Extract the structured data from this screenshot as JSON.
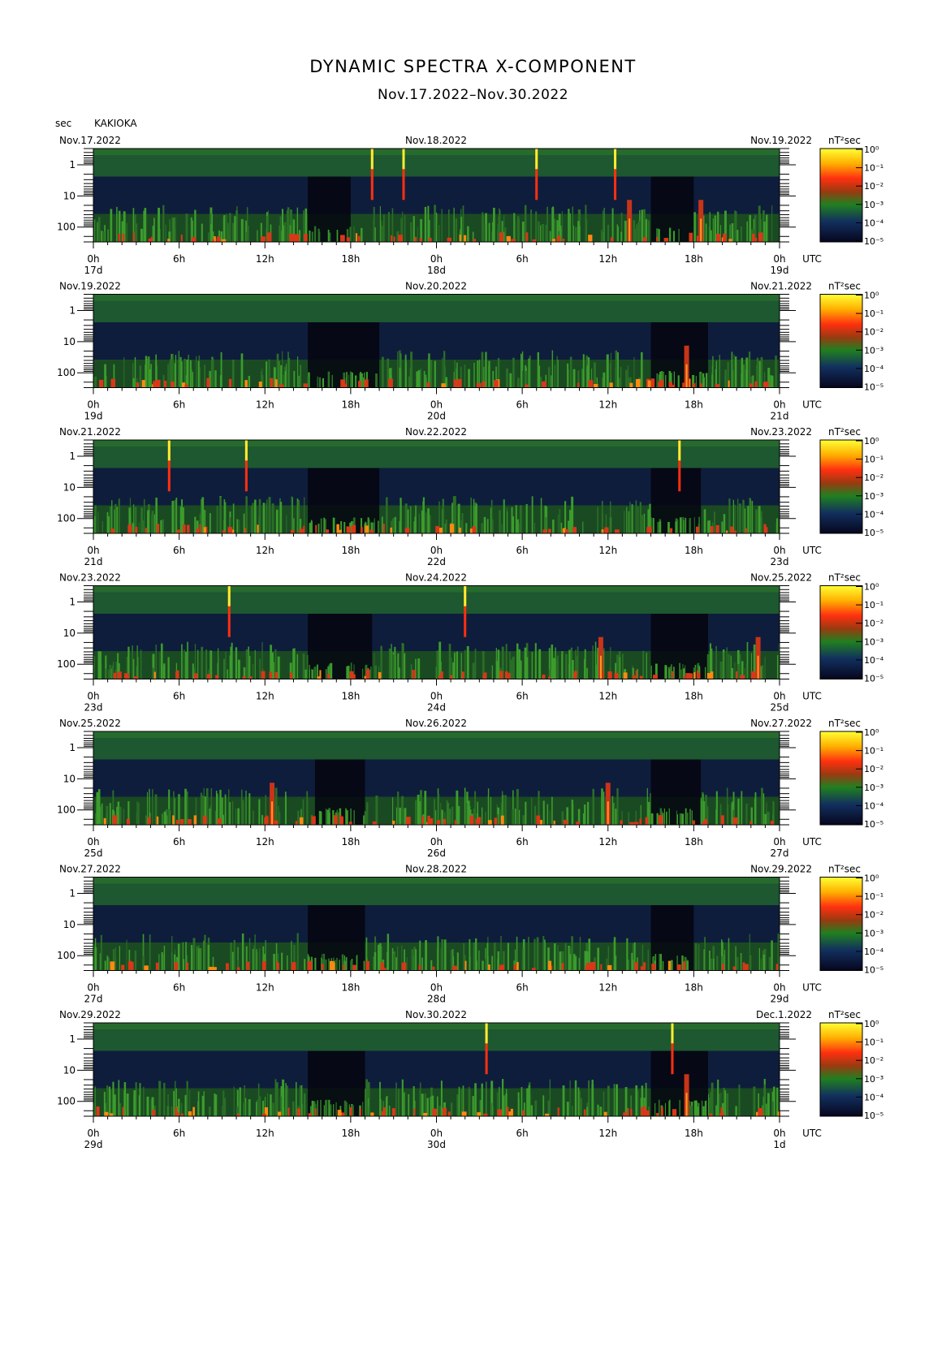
{
  "title": "DYNAMIC SPECTRA X-COMPONENT",
  "subtitle": "Nov.17.2022–Nov.30.2022",
  "station": "KAKIOKA",
  "period_unit": "sec",
  "colorbar_unit": "nT²sec",
  "utc_label": "UTC",
  "chart_data": {
    "type": "heatmap",
    "y_axis": {
      "label": "sec",
      "scale": "log",
      "range": [
        0.3,
        300
      ],
      "ticks": [
        "1",
        "10",
        "100"
      ],
      "direction": "increasing downward"
    },
    "x_ticks": [
      "0h",
      "6h",
      "12h",
      "18h",
      "0h",
      "6h",
      "12h",
      "18h",
      "0h"
    ],
    "colorscale": {
      "unit": "nT²sec",
      "range": [
        1e-05,
        1
      ],
      "labels": [
        "10⁰",
        "10⁻¹",
        "10⁻²",
        "10⁻³",
        "10⁻⁴",
        "10⁻⁵"
      ],
      "colors": [
        "#ffff33",
        "#ffb000",
        "#ff3010",
        "#b03a10",
        "#208020",
        "#12305e",
        "#06061e"
      ]
    },
    "panels": [
      {
        "start_date": "Nov.17.2022",
        "mid_date": "Nov.18.2022",
        "end_date": "Nov.19.2022",
        "day_labels": [
          "17d",
          "18d",
          "19d"
        ],
        "spikes_hours": [
          19.5,
          21.7,
          31.0,
          36.5
        ],
        "bursts_hours": [
          37.5,
          42.5
        ],
        "quiet_hours": [
          [
            15.0,
            18.0
          ],
          [
            39.0,
            42.0
          ]
        ]
      },
      {
        "start_date": "Nov.19.2022",
        "mid_date": "Nov.20.2022",
        "end_date": "Nov.21.2022",
        "day_labels": [
          "19d",
          "20d",
          "21d"
        ],
        "spikes_hours": [],
        "bursts_hours": [
          41.5
        ],
        "quiet_hours": [
          [
            15.0,
            20.0
          ],
          [
            39.0,
            43.0
          ]
        ]
      },
      {
        "start_date": "Nov.21.2022",
        "mid_date": "Nov.22.2022",
        "end_date": "Nov.23.2022",
        "day_labels": [
          "21d",
          "22d",
          "23d"
        ],
        "spikes_hours": [
          5.3,
          10.7,
          41.0
        ],
        "bursts_hours": [],
        "quiet_hours": [
          [
            15.0,
            20.0
          ],
          [
            39.0,
            42.5
          ]
        ]
      },
      {
        "start_date": "Nov.23.2022",
        "mid_date": "Nov.24.2022",
        "end_date": "Nov.25.2022",
        "day_labels": [
          "23d",
          "24d",
          "25d"
        ],
        "spikes_hours": [
          9.5,
          26.0
        ],
        "bursts_hours": [
          35.5,
          46.5
        ],
        "quiet_hours": [
          [
            15.0,
            19.5
          ],
          [
            39.0,
            43.0
          ]
        ]
      },
      {
        "start_date": "Nov.25.2022",
        "mid_date": "Nov.26.2022",
        "end_date": "Nov.27.2022",
        "day_labels": [
          "25d",
          "26d",
          "27d"
        ],
        "spikes_hours": [],
        "bursts_hours": [
          12.5,
          36.0
        ],
        "quiet_hours": [
          [
            15.5,
            19.0
          ],
          [
            39.0,
            42.5
          ]
        ]
      },
      {
        "start_date": "Nov.27.2022",
        "mid_date": "Nov.28.2022",
        "end_date": "Nov.29.2022",
        "day_labels": [
          "27d",
          "28d",
          "29d"
        ],
        "spikes_hours": [],
        "bursts_hours": [],
        "quiet_hours": [
          [
            15.0,
            19.0
          ],
          [
            39.0,
            42.0
          ]
        ]
      },
      {
        "start_date": "Nov.29.2022",
        "mid_date": "Nov.30.2022",
        "end_date": "Dec.1.2022",
        "day_labels": [
          "29d",
          "30d",
          "1d"
        ],
        "spikes_hours": [
          27.5,
          40.5
        ],
        "bursts_hours": [
          41.5
        ],
        "quiet_hours": [
          [
            15.0,
            19.0
          ],
          [
            39.0,
            43.0
          ]
        ]
      }
    ]
  }
}
